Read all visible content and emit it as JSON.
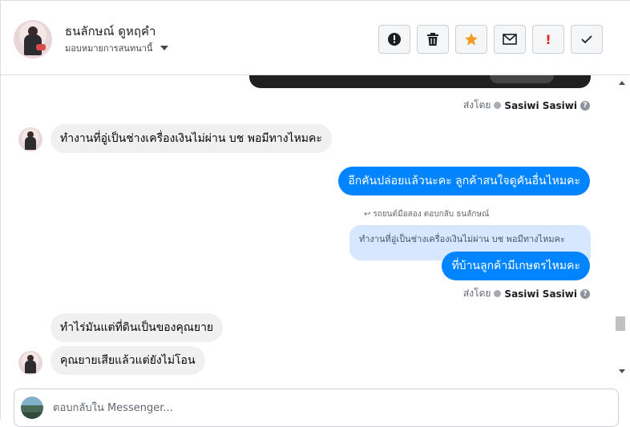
{
  "header": {
    "contact_name": "ธนลักษณ์ ดูหฤคำ",
    "assign_label": "มอบหมายการสนทนานี้",
    "actions": [
      {
        "icon": "alert-circle-icon",
        "label": "!"
      },
      {
        "icon": "trash-icon",
        "label": ""
      },
      {
        "icon": "star-icon",
        "label": ""
      },
      {
        "icon": "envelope-icon",
        "label": ""
      },
      {
        "icon": "exclamation-icon",
        "label": "!"
      },
      {
        "icon": "check-icon",
        "label": ""
      }
    ]
  },
  "messages": {
    "sent_by_1": {
      "prefix": "ส่งโดย",
      "name": "Sasiwi Sasiwi"
    },
    "in_1": "ทำงานที่อู่เป็นช่างเครื่องเงินไม่ผ่าน บช พอมีทางไหมคะ",
    "out_1": "อีกคันปล่อยแล้วนะคะ ลูกค้าสนใจดูคันอื่นไหมคะ",
    "reply_meta": "รถยนต์มือสอง ตอบกลับ ธนลักษณ์",
    "quoted": "ทำงานที่อู่เป็นช่างเครื่องเงินไม่ผ่าน บช พอมีทางไหมคะ",
    "out_2": "ที่บ้านลูกค้ามีเกษตรไหมคะ",
    "sent_by_2": {
      "prefix": "ส่งโดย",
      "name": "Sasiwi Sasiwi"
    },
    "in_2": "ทำไร่มันแต่ที่ดินเป็นของคุณยาย",
    "in_3": "คุณยายเสียแล้วแต่ยังไม่โอน"
  },
  "composer": {
    "placeholder": "ตอบกลับใน Messenger..."
  },
  "colors": {
    "accent": "#0084ff",
    "star": "#f59b23",
    "alert_red": "#e02424",
    "incoming_bubble": "#f0f0f0",
    "quoted_bubble": "#d7e7ff"
  }
}
